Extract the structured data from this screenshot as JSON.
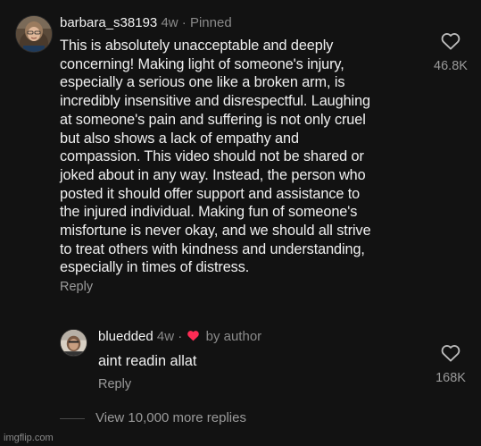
{
  "comment": {
    "username": "barbara_s38193",
    "age": "4w",
    "separator": "·",
    "pinned_label": "Pinned",
    "text": "This is absolutely unacceptable and deeply\nconcerning! Making light of someone's injury,\nespecially a serious one like a broken arm, is\nincredibly insensitive and disrespectful. Laughing\nat someone's pain and suffering is not only cruel\nbut also shows a lack of empathy and\ncompassion. This video should not be shared or\njoked about in any way. Instead, the person who\nposted it should offer support and assistance to\nthe injured individual. Making fun of someone's\nmisfortune is never okay, and we should all strive\nto treat others with kindness and understanding,\nespecially in times of distress.",
    "reply_label": "Reply",
    "like_count": "46.8K",
    "like_icon": "heart-outline-icon"
  },
  "reply": {
    "username": "bluedded",
    "age": "4w",
    "separator": "·",
    "author_badge_icon": "heart-filled-icon",
    "author_badge_color": "#fe2c55",
    "author_label": "by author",
    "text": "aint readin allat",
    "reply_label": "Reply",
    "like_count": "168K",
    "like_icon": "heart-outline-icon"
  },
  "view_more": {
    "label": "View 10,000 more replies"
  },
  "watermark": "imgflip.com",
  "colors": {
    "background": "#121212",
    "text_primary": "#f0f0f0",
    "text_muted": "#9a9a9a",
    "accent_heart": "#fe2c55"
  }
}
